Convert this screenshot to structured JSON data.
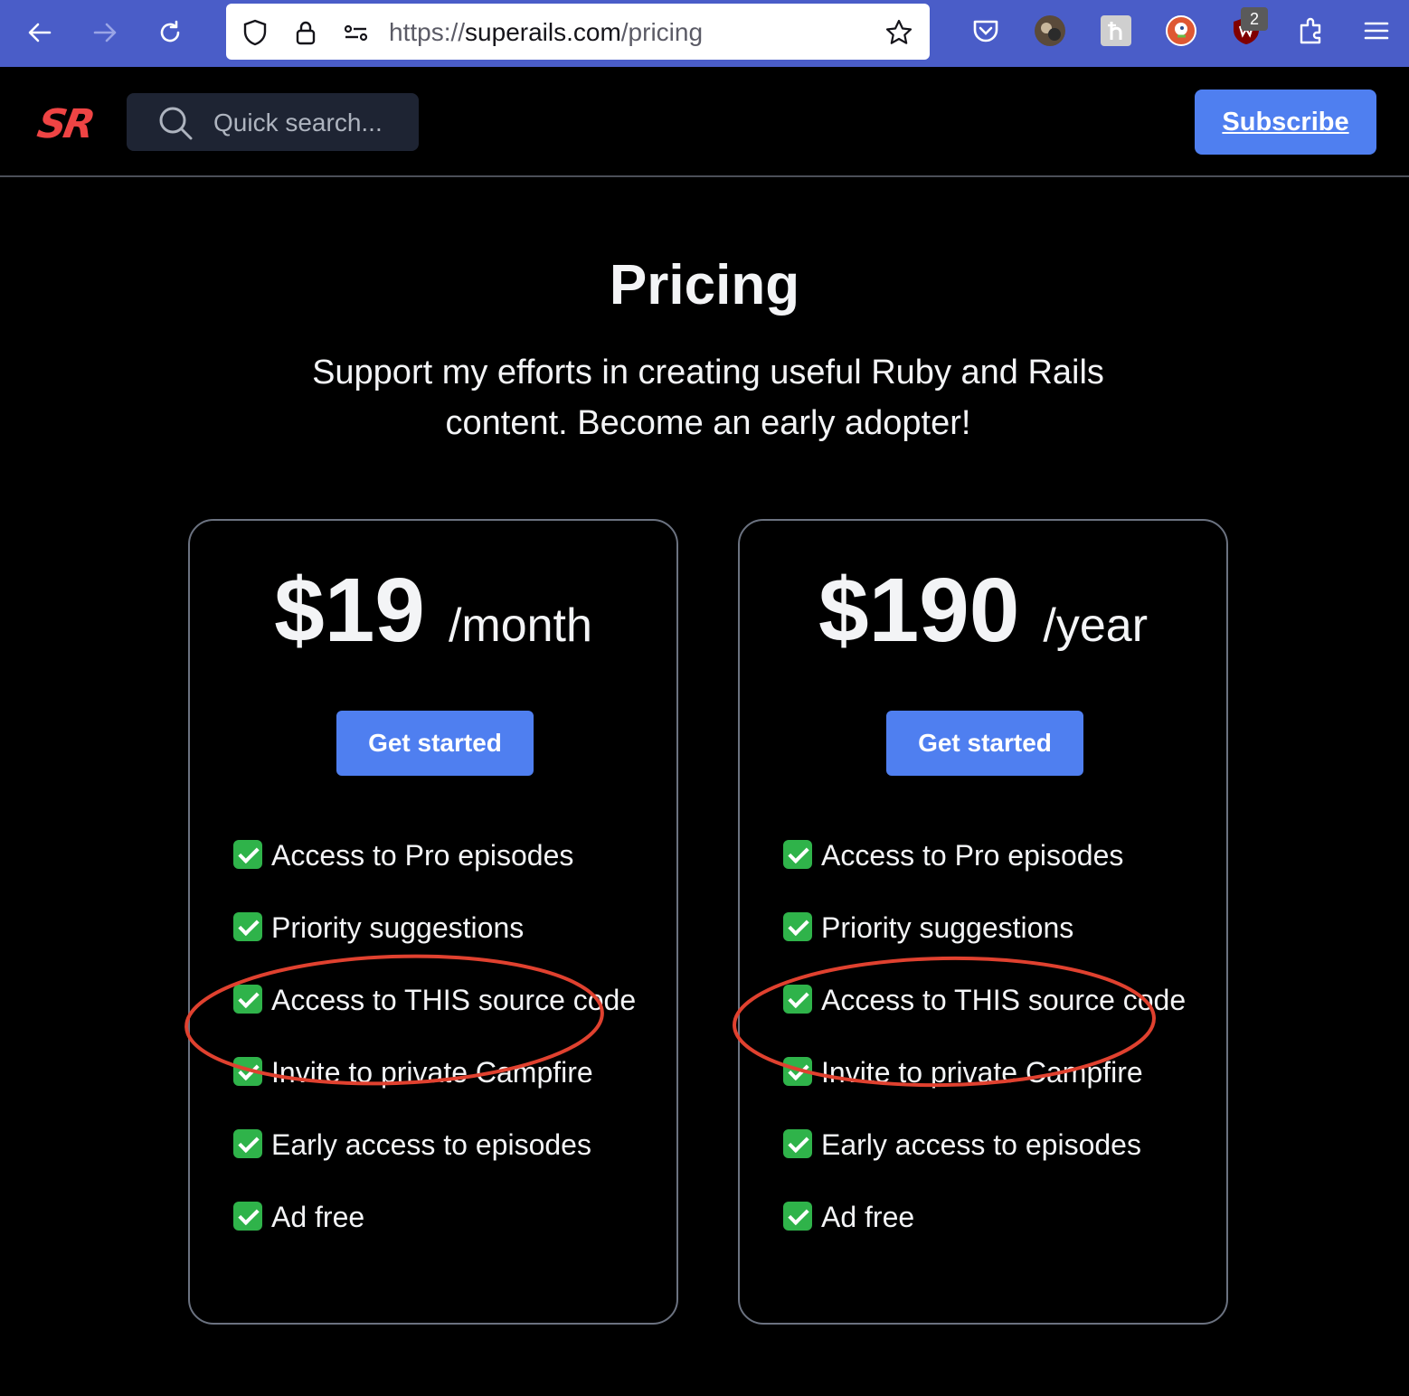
{
  "browser": {
    "url_prefix": "https://",
    "url_host": "superails.com",
    "url_path": "/pricing",
    "extension_badge": "2"
  },
  "header": {
    "logo": "SR",
    "search_placeholder": "Quick search...",
    "subscribe_label": "Subscribe"
  },
  "hero": {
    "title": "Pricing",
    "subtitle": "Support my efforts in creating useful Ruby and Rails content. Become an early adopter!"
  },
  "plans": [
    {
      "price": "$19",
      "period": "/month",
      "cta": "Get started",
      "features": [
        "Access to Pro episodes",
        "Priority suggestions",
        "Access to THIS source code",
        "Invite to private Campfire",
        "Early access to episodes",
        "Ad free"
      ]
    },
    {
      "price": "$190",
      "period": "/year",
      "cta": "Get started",
      "features": [
        "Access to Pro episodes",
        "Priority suggestions",
        "Access to THIS source code",
        "Invite to private Campfire",
        "Early access to episodes",
        "Ad free"
      ]
    }
  ],
  "colors": {
    "browser_toolbar": "#4a5dc8",
    "background": "#000000",
    "accent_button": "#4f7ff0",
    "logo": "#ef4444",
    "annotation": "#e0412f",
    "check": "#2fb34a"
  },
  "icons": [
    "back-icon",
    "forward-icon",
    "reload-icon",
    "shield-icon",
    "lock-icon",
    "permissions-icon",
    "bookmark-star-icon",
    "pocket-icon",
    "avatar-icon",
    "h-extension-icon",
    "duckduckgo-icon",
    "ublock-icon",
    "extensions-icon",
    "menu-icon",
    "search-icon",
    "check-icon"
  ]
}
